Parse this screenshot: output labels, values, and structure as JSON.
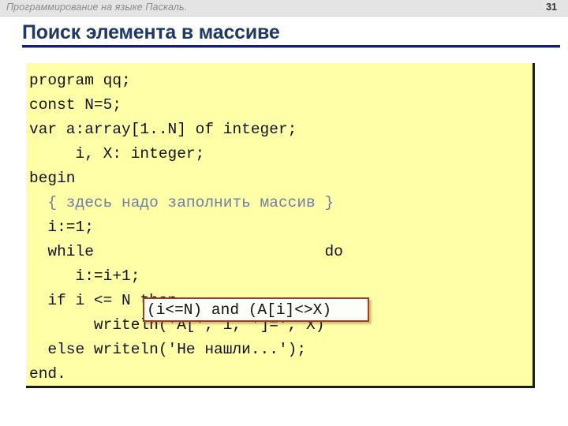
{
  "header": {
    "subject": "Программирование на языке Паскаль.",
    "page_number": "31",
    "bar_color": "#e4e4e4",
    "text_color": "#8c8c8c"
  },
  "title": {
    "text": "Поиск элемента в массиве",
    "color": "#1f3864",
    "rule_color": "#151e6e"
  },
  "code_panel": {
    "background_color": "#ffffa8",
    "text_color": "#111111",
    "comment_color": "#6f7fa6",
    "lines": [
      "program qq;",
      "const N=5;",
      "var a:array[1..N] of integer;",
      "     i, X: integer;",
      "begin",
      "  { здесь надо заполнить массив }",
      "  i:=1;",
      "  while                         do",
      "     i:=i+1;",
      "  if i <= N then",
      "       writeln('A[', i, ']=', X)",
      "  else writeln('Не нашли...');",
      "end."
    ],
    "line_kinds": [
      "code",
      "code",
      "code",
      "code",
      "code",
      "comment",
      "code",
      "code",
      "code",
      "code",
      "code",
      "code",
      "code"
    ]
  },
  "highlight": {
    "text": "(i<=N) and (A[i]<>X)",
    "border_color": "#a23a24",
    "background_color": "#fdfdfa"
  }
}
